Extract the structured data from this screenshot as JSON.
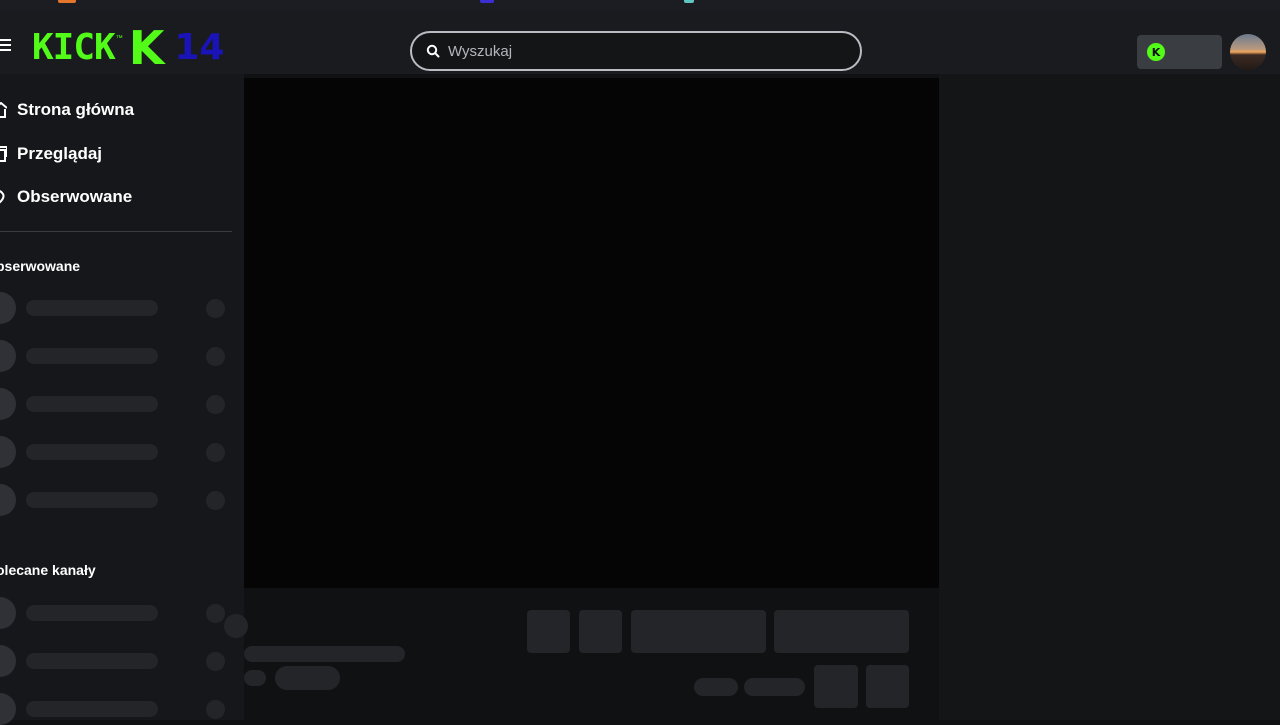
{
  "header": {
    "logo": {
      "wordmark": "KICK",
      "trademark": "™",
      "mark": "K",
      "number": "14"
    },
    "search": {
      "placeholder": "Wyszukaj"
    },
    "coin_button": {
      "icon": "kick-coin-icon",
      "symbol": "K"
    }
  },
  "sidebar": {
    "nav": [
      {
        "label": "Strona główna",
        "icon": "home-icon"
      },
      {
        "label": "Przeglądaj",
        "icon": "browse-icon"
      },
      {
        "label": "Obserwowane",
        "icon": "heart-icon"
      }
    ],
    "sections": [
      {
        "title": "bserwowane"
      },
      {
        "title": "olecane kanały"
      }
    ]
  },
  "colors": {
    "brand": "#53fc18",
    "number": "#1a13b8",
    "background": "#101113",
    "skeleton": "#232529"
  }
}
